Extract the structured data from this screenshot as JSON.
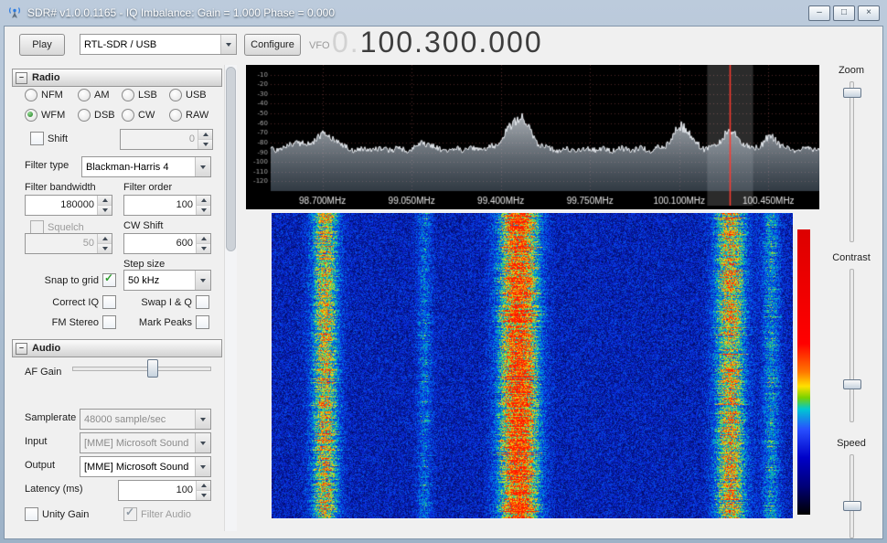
{
  "window": {
    "title": "SDR# v1.0.0.1165 - IQ Imbalance: Gain = 1.000 Phase = 0.000"
  },
  "icons": {
    "minimize": "–",
    "maximize": "□",
    "close": "×",
    "collapse": "–"
  },
  "toolbar": {
    "play_label": "Play",
    "source_value": "RTL-SDR / USB",
    "configure_label": "Configure",
    "vfo_label": "VFO",
    "frequency_prefix": "0.",
    "frequency_value": "100.300.000"
  },
  "radio_panel": {
    "title": "Radio",
    "modes": [
      {
        "label": "NFM",
        "selected": false
      },
      {
        "label": "AM",
        "selected": false
      },
      {
        "label": "LSB",
        "selected": false
      },
      {
        "label": "USB",
        "selected": false
      },
      {
        "label": "WFM",
        "selected": true
      },
      {
        "label": "DSB",
        "selected": false
      },
      {
        "label": "CW",
        "selected": false
      },
      {
        "label": "RAW",
        "selected": false
      }
    ],
    "shift": {
      "label": "Shift",
      "checked": false,
      "value": "0"
    },
    "filter_type_label": "Filter type",
    "filter_type_value": "Blackman-Harris 4",
    "filter_bandwidth_label": "Filter bandwidth",
    "filter_bandwidth_value": "180000",
    "filter_order_label": "Filter order",
    "filter_order_value": "100",
    "squelch": {
      "label": "Squelch",
      "checked": false,
      "value": "50"
    },
    "cw_shift_label": "CW Shift",
    "cw_shift_value": "600",
    "step_size_label": "Step size",
    "step_size_value": "50 kHz",
    "snap_to_grid": {
      "label": "Snap to grid",
      "checked": true
    },
    "correct_iq": {
      "label": "Correct IQ",
      "checked": false
    },
    "swap_iq": {
      "label": "Swap I & Q",
      "checked": false
    },
    "fm_stereo": {
      "label": "FM Stereo",
      "checked": false
    },
    "mark_peaks": {
      "label": "Mark Peaks",
      "checked": false
    }
  },
  "audio_panel": {
    "title": "Audio",
    "af_gain_label": "AF Gain",
    "af_gain_pct": 57,
    "samplerate_label": "Samplerate",
    "samplerate_value": "48000 sample/sec",
    "input_label": "Input",
    "input_value": "[MME] Microsoft Sound",
    "output_label": "Output",
    "output_value": "[MME] Microsoft Sound",
    "latency_label": "Latency (ms)",
    "latency_value": "100",
    "unity_gain": {
      "label": "Unity Gain",
      "checked": false
    },
    "filter_audio": {
      "label": "Filter Audio",
      "checked": true
    }
  },
  "right_panel": {
    "zoom_label": "Zoom",
    "zoom_pct": 4,
    "contrast_label": "Contrast",
    "contrast_pct": 72,
    "speed_label": "Speed",
    "speed_pct": 55
  },
  "waterfall": {
    "colorbar_stops": [
      "#dc0000 0%",
      "#ff0000 40%",
      "#ff7800 50%",
      "#ffe000 55%",
      "#78d200 59%",
      "#00c8d2 63%",
      "#2850ff 70%",
      "#0000c8 80%",
      "#000078 90%",
      "#000000 100%"
    ]
  },
  "chart_data": {
    "type": "area",
    "title": "RF spectrum (FFT) with waterfall",
    "x_range_mhz": [
      98.4,
      100.65
    ],
    "x_ticks_mhz": [
      98.7,
      99.05,
      99.4,
      99.75,
      100.1,
      100.45
    ],
    "x_tick_labels": [
      "98.700MHz",
      "99.050MHz",
      "99.400MHz",
      "99.750MHz",
      "100.100MHz",
      "100.450MHz"
    ],
    "y_range_db": [
      -130,
      0
    ],
    "y_tick_step_db": 10,
    "noise_floor_db": -87,
    "tuned_mhz": 100.3,
    "bandwidth_khz": 180,
    "peaks": [
      {
        "mhz": 98.6,
        "db": -80,
        "width_mhz": 0.025
      },
      {
        "mhz": 98.71,
        "db": -70,
        "width_mhz": 0.04
      },
      {
        "mhz": 99.1,
        "db": -80,
        "width_mhz": 0.025
      },
      {
        "mhz": 99.47,
        "db": -54,
        "width_mhz": 0.045
      },
      {
        "mhz": 100.11,
        "db": -63,
        "width_mhz": 0.035
      },
      {
        "mhz": 100.3,
        "db": -68,
        "width_mhz": 0.035
      },
      {
        "mhz": 100.46,
        "db": -75,
        "width_mhz": 0.03
      }
    ],
    "waterfall_streaks": [
      {
        "mhz": 98.71,
        "strength": 0.62,
        "width_khz": 70
      },
      {
        "mhz": 99.1,
        "strength": 0.2,
        "width_khz": 40
      },
      {
        "mhz": 99.47,
        "strength": 1.0,
        "width_khz": 100
      },
      {
        "mhz": 100.3,
        "strength": 0.66,
        "width_khz": 80
      },
      {
        "mhz": 100.46,
        "strength": 0.28,
        "width_khz": 50
      }
    ]
  }
}
